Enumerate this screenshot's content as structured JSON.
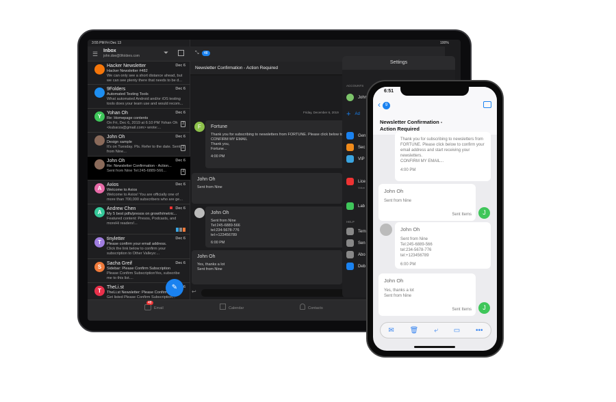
{
  "ipad": {
    "status": {
      "time": "3:55 PM  Fri Dec 13",
      "battery": "100%"
    },
    "inbox": {
      "title": "Inbox",
      "account": "john.doe@9folders.com"
    },
    "emails": [
      {
        "name": "Hacker Newsletter",
        "date": "Dec 6",
        "subject": "Hacker Newsletter #482",
        "preview": "We can only see a short distance ahead, but we can see plenty there that needs to be d...",
        "avatar": "",
        "color": "#f5760a"
      },
      {
        "name": "9Folders",
        "date": "Dec 6",
        "subject": "Automated Testing Tools",
        "preview": "What automated Android and/or iOS testing tools does your team use and would recom...",
        "avatar": "",
        "color": "#1e8ef0"
      },
      {
        "name": "Yohan Oh",
        "date": "Dec 6",
        "subject": "Re: Homepage contents",
        "preview": "On Fri, Dec 6, 2019 at 6:10 PM Yohan Oh <kubarza@gmail.com> wrote:...",
        "avatar": "Y",
        "color": "#3fc65a",
        "count": "2"
      },
      {
        "name": "John Oh",
        "date": "Dec 6",
        "subject": "Design sample",
        "preview": "It's on Tuesday. Pls. Refer to the date. Sent from Nine...",
        "avatar": "",
        "color": "#8a6a5a",
        "count": "2"
      },
      {
        "name": "John Oh",
        "date": "Dec 6",
        "subject": "Re: Newsletter Confirmation - Action...",
        "preview": "Sent from Nine Tel:245-6889-566...",
        "avatar": "",
        "color": "#8a6a5a",
        "count": "4",
        "selected": true
      },
      {
        "name": "Axios",
        "date": "Dec 6",
        "subject": "Welcome to Axios",
        "preview": "Welcome to Axios! You are officially one of more than 700,000 subscribers who are ge...",
        "avatar": "A",
        "color": "#e86aa8"
      },
      {
        "name": "Andrew Chen",
        "date": "Dec 6",
        "subject": "My 5 best pdfs/presos on growth/metric...",
        "preview": "Featured content: Presos, Podcasts, and moreHi readers!...",
        "avatar": "A",
        "color": "#35c99a",
        "flag": true
      },
      {
        "name": "tinyletter",
        "date": "Dec 6",
        "subject": "Please confirm your email address.",
        "preview": "Click the link below to confirm your subscription to Other Valleys:...",
        "avatar": "T",
        "color": "#a07de0"
      },
      {
        "name": "Sacha Greif",
        "date": "Dec 6",
        "subject": "Sidebar: Please Confirm Subscription",
        "preview": "Please Confirm SubscriptionYes, subscribe me to this list....",
        "avatar": "S",
        "color": "#f07a3a"
      },
      {
        "name": "TheLi.st",
        "date": "Dec 6",
        "subject": "TheLi.st Newsletter: Please Confirm Sub...",
        "preview": "Get listed Please Confirm Subscription...",
        "avatar": "T",
        "color": "#e8304a"
      }
    ],
    "thread": {
      "badge": "48",
      "title": "Newsletter Confirmation - Action Required",
      "date_divider": "Friday, December 6, 2019",
      "messages": [
        {
          "from": "Fortune",
          "avatar": "F",
          "body": [
            "Thank you for subscribing to newsletters from FORTUNE. Please click below to confirm your email address and start receiving your newsletters.",
            "CONFIRM MY EMAIL",
            "Thank you,",
            "Fortune..."
          ],
          "time": "4:00 PM"
        },
        {
          "from": "John Oh",
          "body": [
            "Sent from Nine"
          ],
          "time": ""
        },
        {
          "from": "John Oh",
          "body": [
            "Sent from Nine",
            "Tel:245-6889-566",
            "tel:234-5678-776",
            "tel:+123456789"
          ],
          "time": "6:00 PM"
        },
        {
          "from": "John Oh",
          "body": [
            "Yes, thanks a lot",
            "Sent from Nine"
          ],
          "time": ""
        }
      ]
    },
    "tabs": {
      "email": "Email",
      "email_badge": "48",
      "calendar": "Calendar",
      "contacts": "Contacts"
    },
    "settings": {
      "title": "Settings",
      "accounts_header": "ACCOUNTS",
      "account_name": "John",
      "account_sub": "john",
      "add": "Ad",
      "items": [
        "Gen",
        "Sec",
        "VIP",
        "Lice",
        "Lab"
      ],
      "license_sub": "Volun",
      "help_header": "HELP",
      "help_items": [
        "Tern",
        "Sen",
        "Abo",
        "Deb"
      ]
    }
  },
  "iphone": {
    "time": "6:51",
    "back_badge": "9",
    "title": "Newsletter Confirmation - Action Required",
    "messages": [
      {
        "body": [
          "Thank you for subscribing to newsletters from FORTUNE. Please click below to confirm your email address and start receiving your newsletters.",
          "CONFIRM MY EMAIL..."
        ],
        "time": "4:00 PM"
      },
      {
        "from": "John Oh",
        "body": [
          "Sent from Nine"
        ],
        "folder": "Sent Items",
        "avatar": "J"
      },
      {
        "from": "John Oh",
        "body": [
          "Sent from Nine",
          "Tel:245-6889-566",
          "tel:234-5678-776",
          "tel:+123456789"
        ],
        "time": "6:00 PM"
      },
      {
        "from": "John Oh",
        "body": [
          "Yes, thanks a lot",
          "Sent from Nine"
        ],
        "folder": "Sent Items",
        "avatar": "J"
      }
    ],
    "toolbar_icons": [
      "mail-icon",
      "trash-icon",
      "reply-icon",
      "move-folder-icon",
      "more-icon"
    ]
  }
}
